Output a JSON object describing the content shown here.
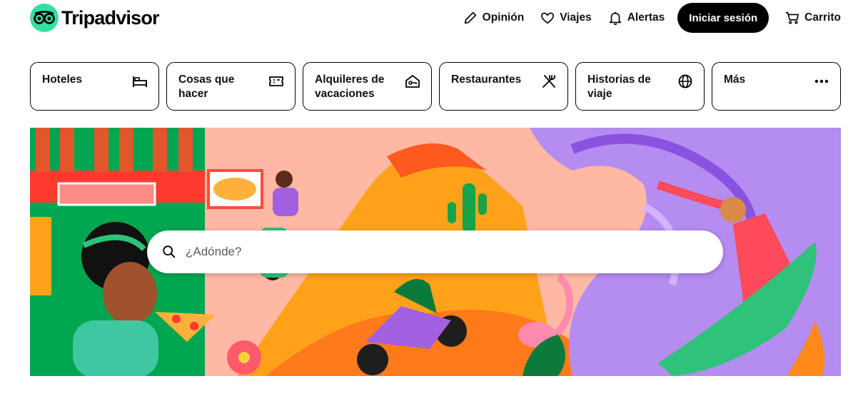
{
  "brand": {
    "name": "Tripadvisor",
    "accent": "#34e0a1"
  },
  "nav": {
    "review_label": "Opinión",
    "trips_label": "Viajes",
    "alerts_label": "Alertas",
    "signin_label": "Iniciar sesión",
    "cart_label": "Carrito"
  },
  "categories": [
    {
      "label": "Hoteles",
      "icon": "bed-icon"
    },
    {
      "label": "Cosas que hacer",
      "icon": "ticket-icon"
    },
    {
      "label": "Alquileres de vacaciones",
      "icon": "house-key-icon"
    },
    {
      "label": "Restaurantes",
      "icon": "fork-knife-icon"
    },
    {
      "label": "Historias de viaje",
      "icon": "globe-icon"
    },
    {
      "label": "Más",
      "icon": "more-dots-icon"
    }
  ],
  "search": {
    "placeholder": "¿Adónde?"
  },
  "colors": {
    "hero_bg": "#ffb8a4",
    "purple": "#b58cf0",
    "orange": "#ffa21a",
    "green": "#00b25a",
    "red": "#ff4a3a"
  }
}
